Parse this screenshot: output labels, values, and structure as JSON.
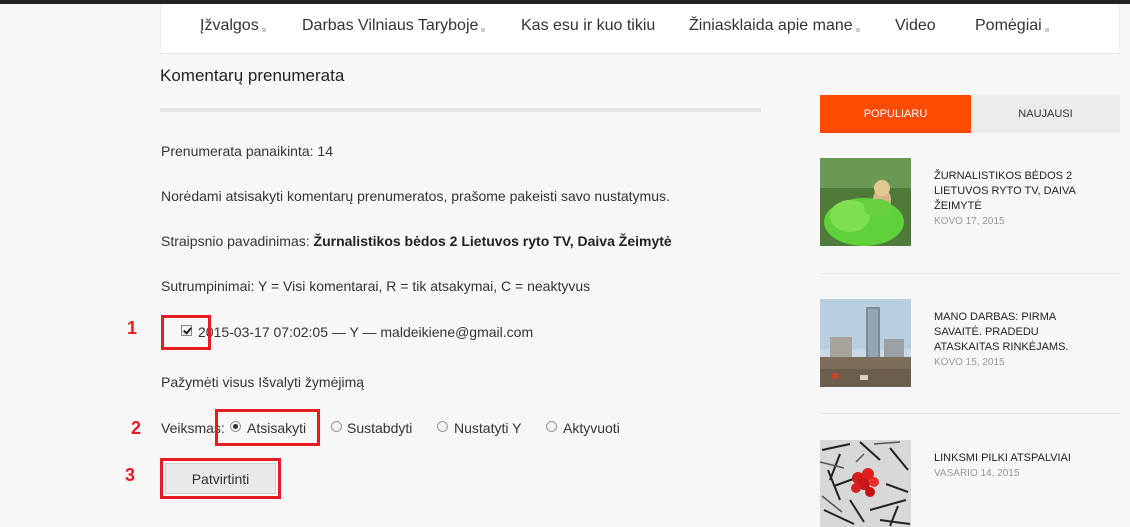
{
  "nav": {
    "items": [
      {
        "label": "Įžvalgos"
      },
      {
        "label": "Darbas Vilniaus Taryboje"
      },
      {
        "label": "Kas esu ir kuo tikiu"
      },
      {
        "label": "Žiniasklaida apie mane"
      },
      {
        "label": "Video"
      },
      {
        "label": "Pomėgiai"
      }
    ]
  },
  "main": {
    "title": "Komentarų prenumerata",
    "status": "Prenumerata panaikinta: 14",
    "instruction": "Norėdami atsisakyti komentarų prenumeratos, prašome pakeisti savo nustatymus.",
    "article_label": "Straipsnio pavadinimas:",
    "article_name": "Žurnalistikos bėdos 2 Lietuvos ryto TV, Daiva Žeimytė",
    "abbreviations": "Sutrumpinimai: Y = Visi komentarai, R = tik atsakymai, C = neaktyvus",
    "subscription_row": "2015-03-17 07:02:05 — Y — maldeikiene@gmail.com",
    "select_all": "Pažymėti visus",
    "clear_selection": "Išvalyti žymėjimą",
    "action_label": "Veiksmas:",
    "actions": [
      {
        "label": "Atsisakyti",
        "selected": true
      },
      {
        "label": "Sustabdyti",
        "selected": false
      },
      {
        "label": "Nustatyti Y",
        "selected": false
      },
      {
        "label": "Aktyvuoti",
        "selected": false
      }
    ],
    "submit_label": "Patvirtinti"
  },
  "annotations": {
    "one": "1",
    "two": "2",
    "three": "3",
    "color": "#e51c23"
  },
  "sidebar": {
    "tabs": [
      {
        "label": "POPULIARU",
        "active": true
      },
      {
        "label": "NAUJAUSI",
        "active": false
      }
    ],
    "posts": [
      {
        "title": "ŽURNALISTIKOS BĖDOS 2 LIETUVOS RYTO TV, DAIVA ŽEIMYTĖ",
        "date": "KOVO 17, 2015"
      },
      {
        "title": "MANO DARBAS: PIRMA SAVAITĖ. PRADEDU ATASKAITAS RINKĖJAMS.",
        "date": "KOVO 15, 2015"
      },
      {
        "title": "LINKSMI PILKI ATSPALVIAI",
        "date": "VASARIO 14, 2015"
      }
    ],
    "accent": "#ff4b00"
  }
}
